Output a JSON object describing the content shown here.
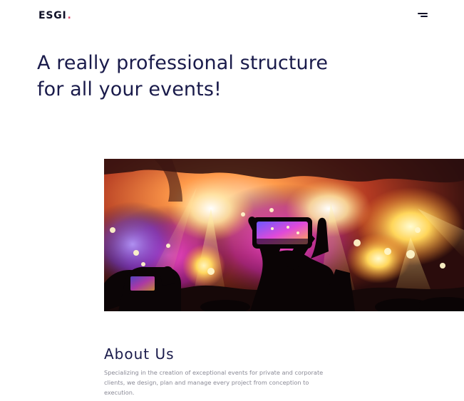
{
  "header": {
    "logo_text": "ESGI",
    "logo_dot": ".",
    "menu_icon": "hamburger-menu-icon"
  },
  "hero": {
    "title_line1": "A really professional structure",
    "title_line2": "for all your events!",
    "image_alt": "Concert crowd filming the stage with phones"
  },
  "about": {
    "title": "About Us",
    "text": "Specializing in the creation of exceptional events for private and corporate clients, we design, plan and manage every project from conception to execution."
  },
  "colors": {
    "text_dark": "#1a1b4b",
    "logo_dark": "#0f1027",
    "accent": "#e24b6d",
    "muted": "#8a8a96",
    "background": "#ffffff"
  }
}
